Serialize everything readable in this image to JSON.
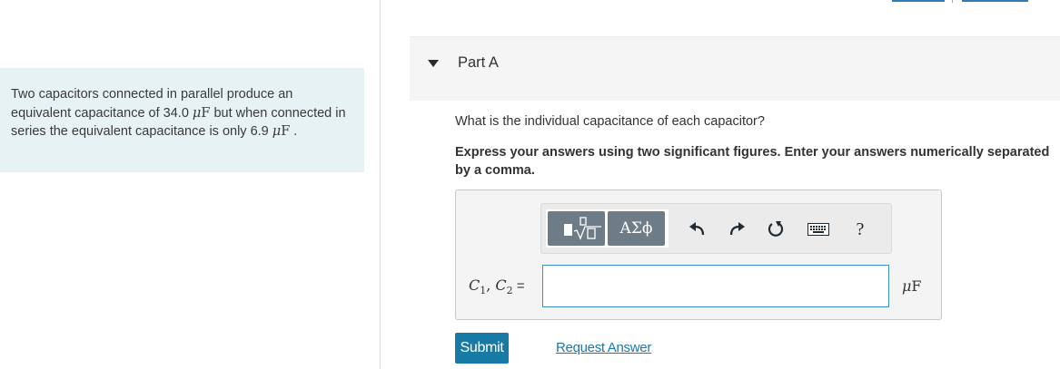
{
  "problem": {
    "text_before_unit1": "Two capacitors connected in parallel produce an equivalent capacitance of 34.0 ",
    "unit1_mu": "μ",
    "unit1_F": "F",
    "text_between": " but when connected in series the equivalent capacitance is only 6.9 ",
    "unit2_mu": "μ",
    "unit2_F": "F",
    "text_end": " ."
  },
  "part": {
    "title": "Part A",
    "question": "What is the individual capacitance of each capacitor?",
    "instruction": "Express your answers using two significant figures. Enter your answers numerically separated by a comma."
  },
  "toolbar": {
    "greek_label": "ΑΣϕ",
    "help_label": "?",
    "icons": [
      "templates-icon",
      "greek-symbols-icon",
      "undo-icon",
      "redo-icon",
      "reset-icon",
      "keyboard-icon",
      "help-icon"
    ]
  },
  "answer": {
    "label_c1": "C",
    "label_c1_sub": "1",
    "label_sep": ", ",
    "label_c2": "C",
    "label_c2_sub": "2",
    "label_eq": " =",
    "value": "",
    "unit_mu": "μ",
    "unit_F": "F"
  },
  "actions": {
    "submit_label": "Submit",
    "request_label": "Request Answer"
  },
  "colors": {
    "panel_bg": "#e6f2f3",
    "submit_bg": "#177aa5",
    "link": "#1a78b5",
    "input_border": "#3c90c8",
    "tool_dark": "#6d7c86"
  }
}
